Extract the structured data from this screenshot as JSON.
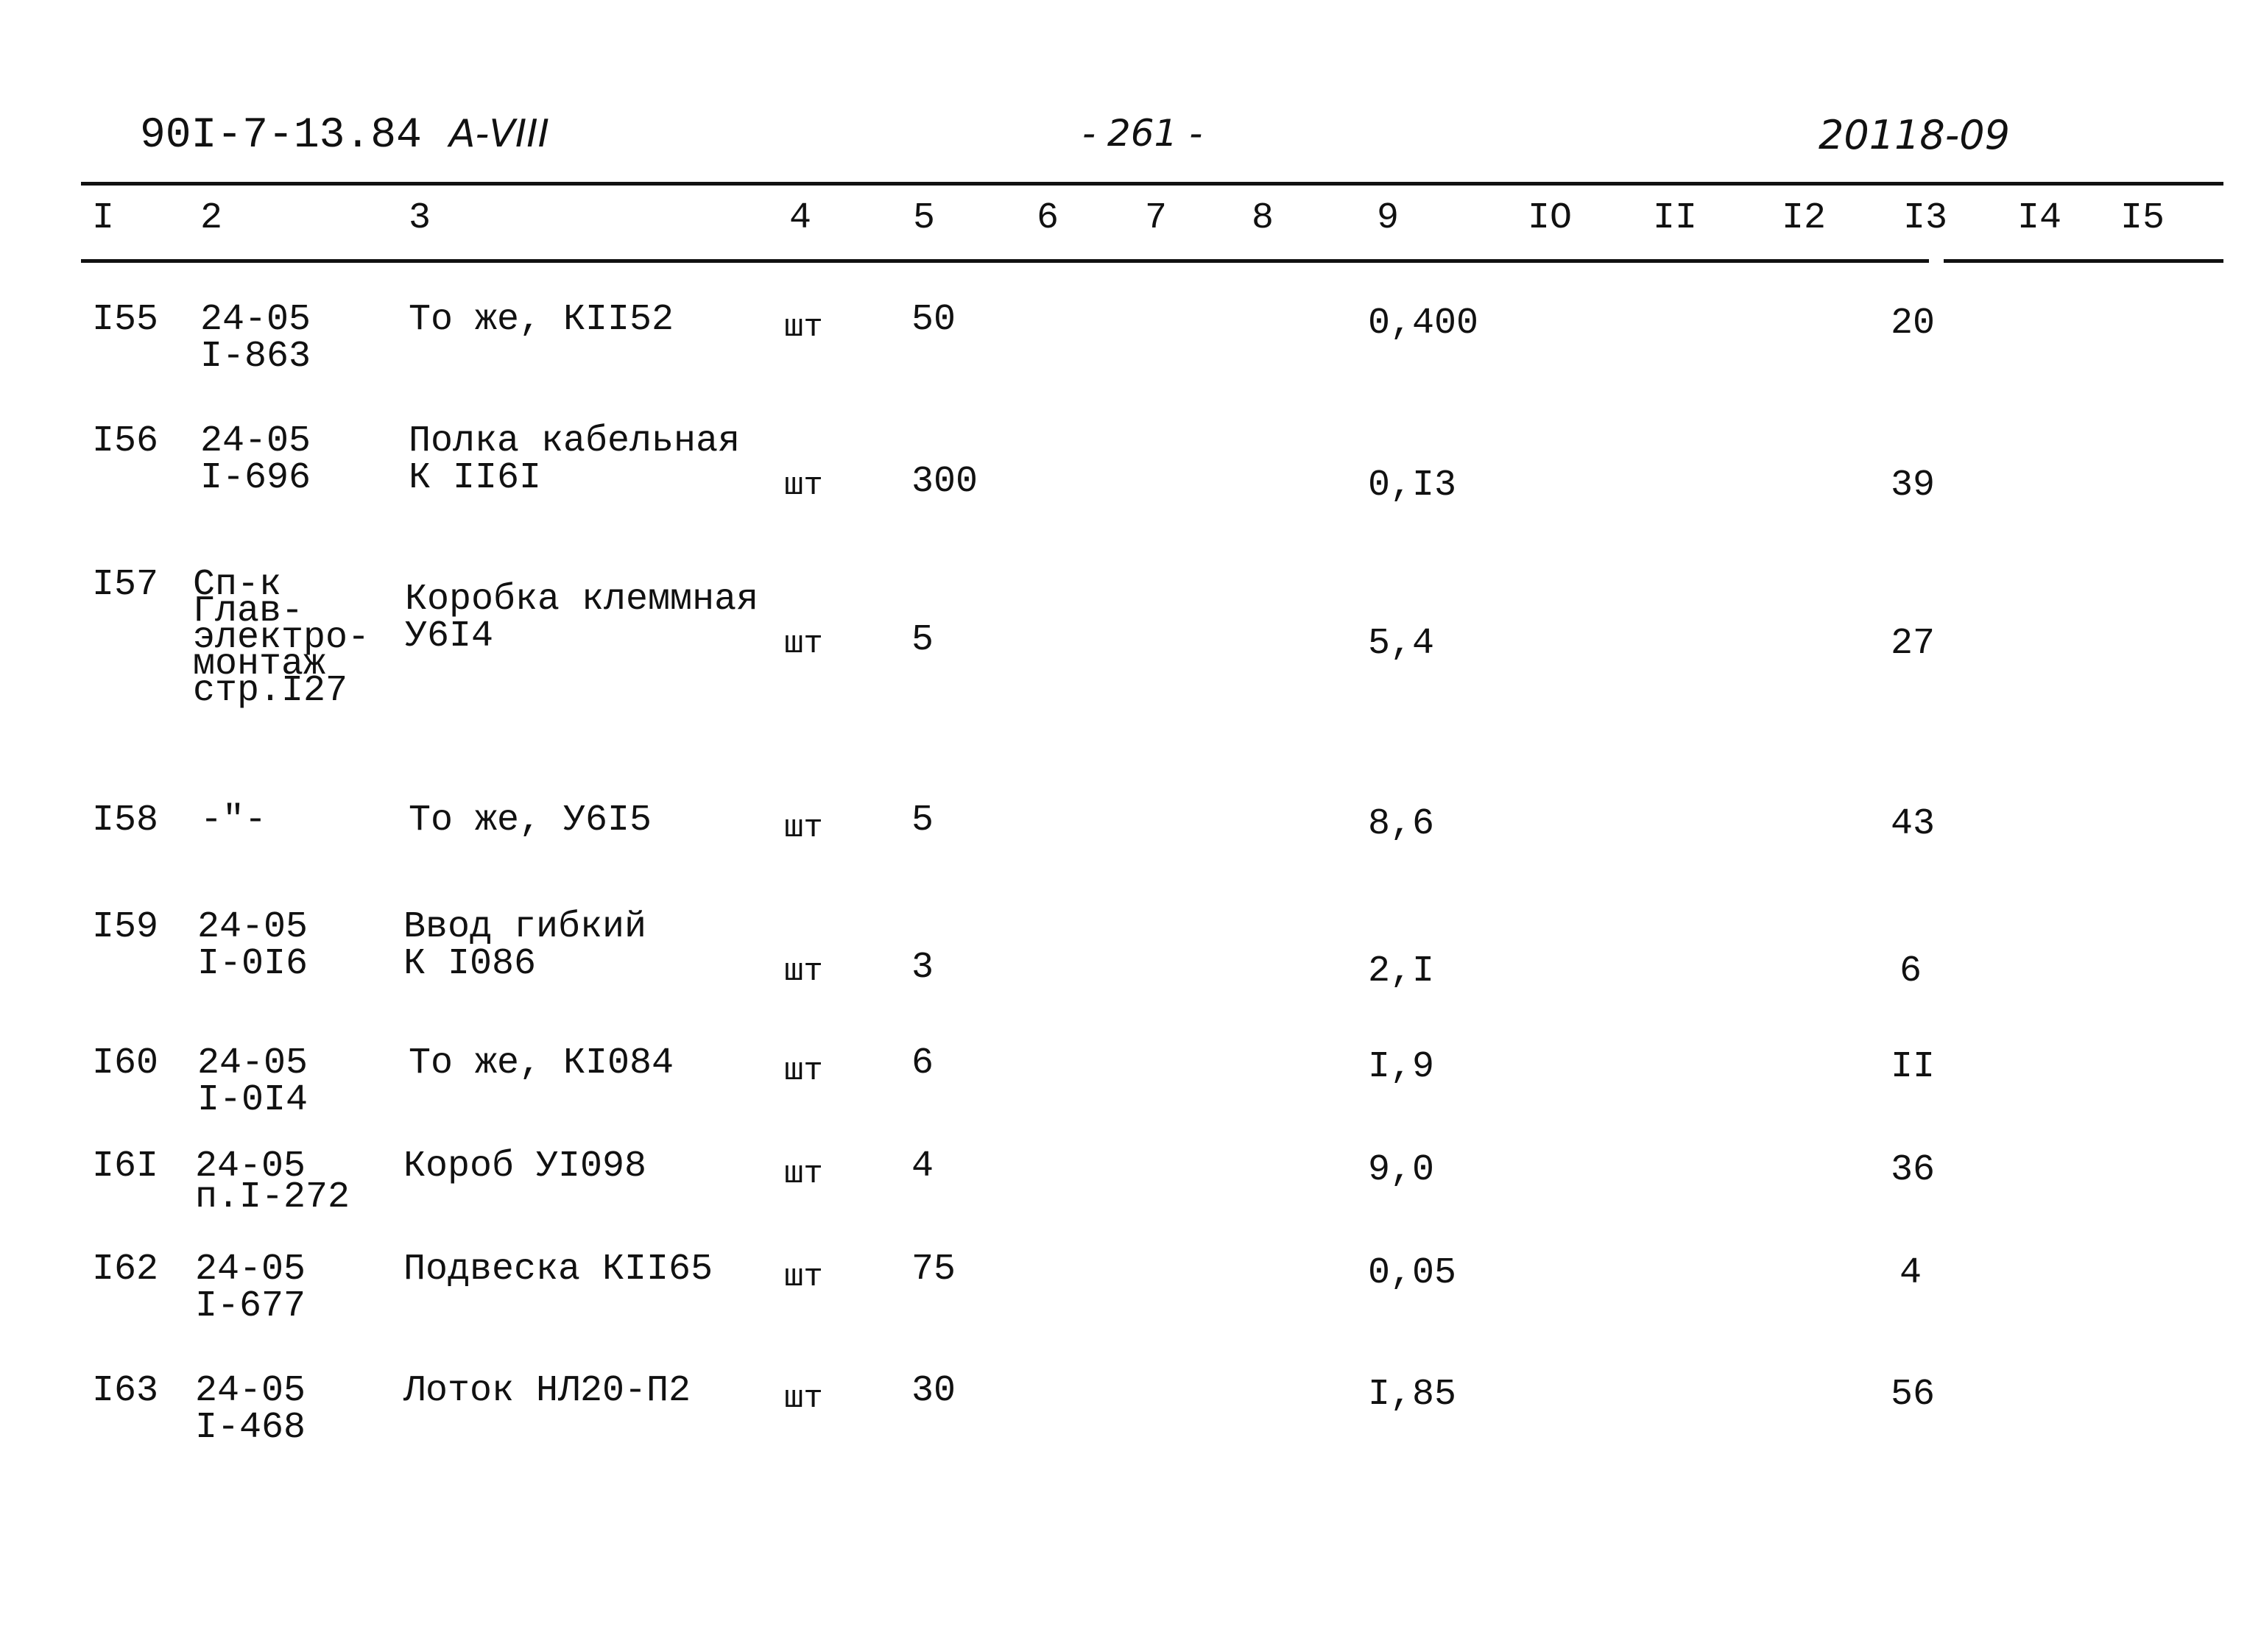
{
  "header": {
    "doc_code": "90I-7-13.84",
    "album": "А-VIII",
    "page": "- 261 -",
    "order_no": "20118-09"
  },
  "columns": [
    "I",
    "2",
    "3",
    "4",
    "5",
    "6",
    "7",
    "8",
    "9",
    "IO",
    "II",
    "I2",
    "I3",
    "I4",
    "I5"
  ],
  "rows": [
    {
      "num": "I55",
      "ref": [
        "24-05",
        "I-863"
      ],
      "name": [
        "То же, КII52"
      ],
      "unit": "шт",
      "qty": "50",
      "c9": "0,400",
      "c13": "20"
    },
    {
      "num": "I56",
      "ref": [
        "24-05",
        "I-696"
      ],
      "name": [
        "Полка кабельная",
        "К II6I"
      ],
      "unit": "шт",
      "qty": "300",
      "c9": "0,I3",
      "c13": "39"
    },
    {
      "num": "I57",
      "ref": [
        "Сп-к",
        "Глав-",
        "электро-",
        "монтаж",
        "стр.I27"
      ],
      "name": [
        "Коробка клеммная",
        "У6I4"
      ],
      "unit": "шт",
      "qty": "5",
      "c9": "5,4",
      "c13": "27"
    },
    {
      "num": "I58",
      "ref": [
        "-\"-"
      ],
      "name": [
        "То же, У6I5"
      ],
      "unit": "шт",
      "qty": "5",
      "c9": "8,6",
      "c13": "43"
    },
    {
      "num": "I59",
      "ref": [
        "24-05",
        "I-0I6"
      ],
      "name": [
        "Ввод гибкий",
        "К I086"
      ],
      "unit": "шт",
      "qty": "3",
      "c9": "2,I",
      "c13": "6"
    },
    {
      "num": "I60",
      "ref": [
        "24-05",
        "I-0I4"
      ],
      "name": [
        "То же, КI084"
      ],
      "unit": "шт",
      "qty": "6",
      "c9": "I,9",
      "c13": "II"
    },
    {
      "num": "I6I",
      "ref": [
        "24-05",
        "п.I-272"
      ],
      "name": [
        "Короб УI098"
      ],
      "unit": "шт",
      "qty": "4",
      "c9": "9,0",
      "c13": "36"
    },
    {
      "num": "I62",
      "ref": [
        "24-05",
        "I-677"
      ],
      "name": [
        "Подвеска КII65"
      ],
      "unit": "шт",
      "qty": "75",
      "c9": "0,05",
      "c13": "4"
    },
    {
      "num": "I63",
      "ref": [
        "24-05",
        "I-468"
      ],
      "name": [
        "Лоток НЛ20-П2"
      ],
      "unit": "шт",
      "qty": "30",
      "c9": "I,85",
      "c13": "56"
    }
  ]
}
